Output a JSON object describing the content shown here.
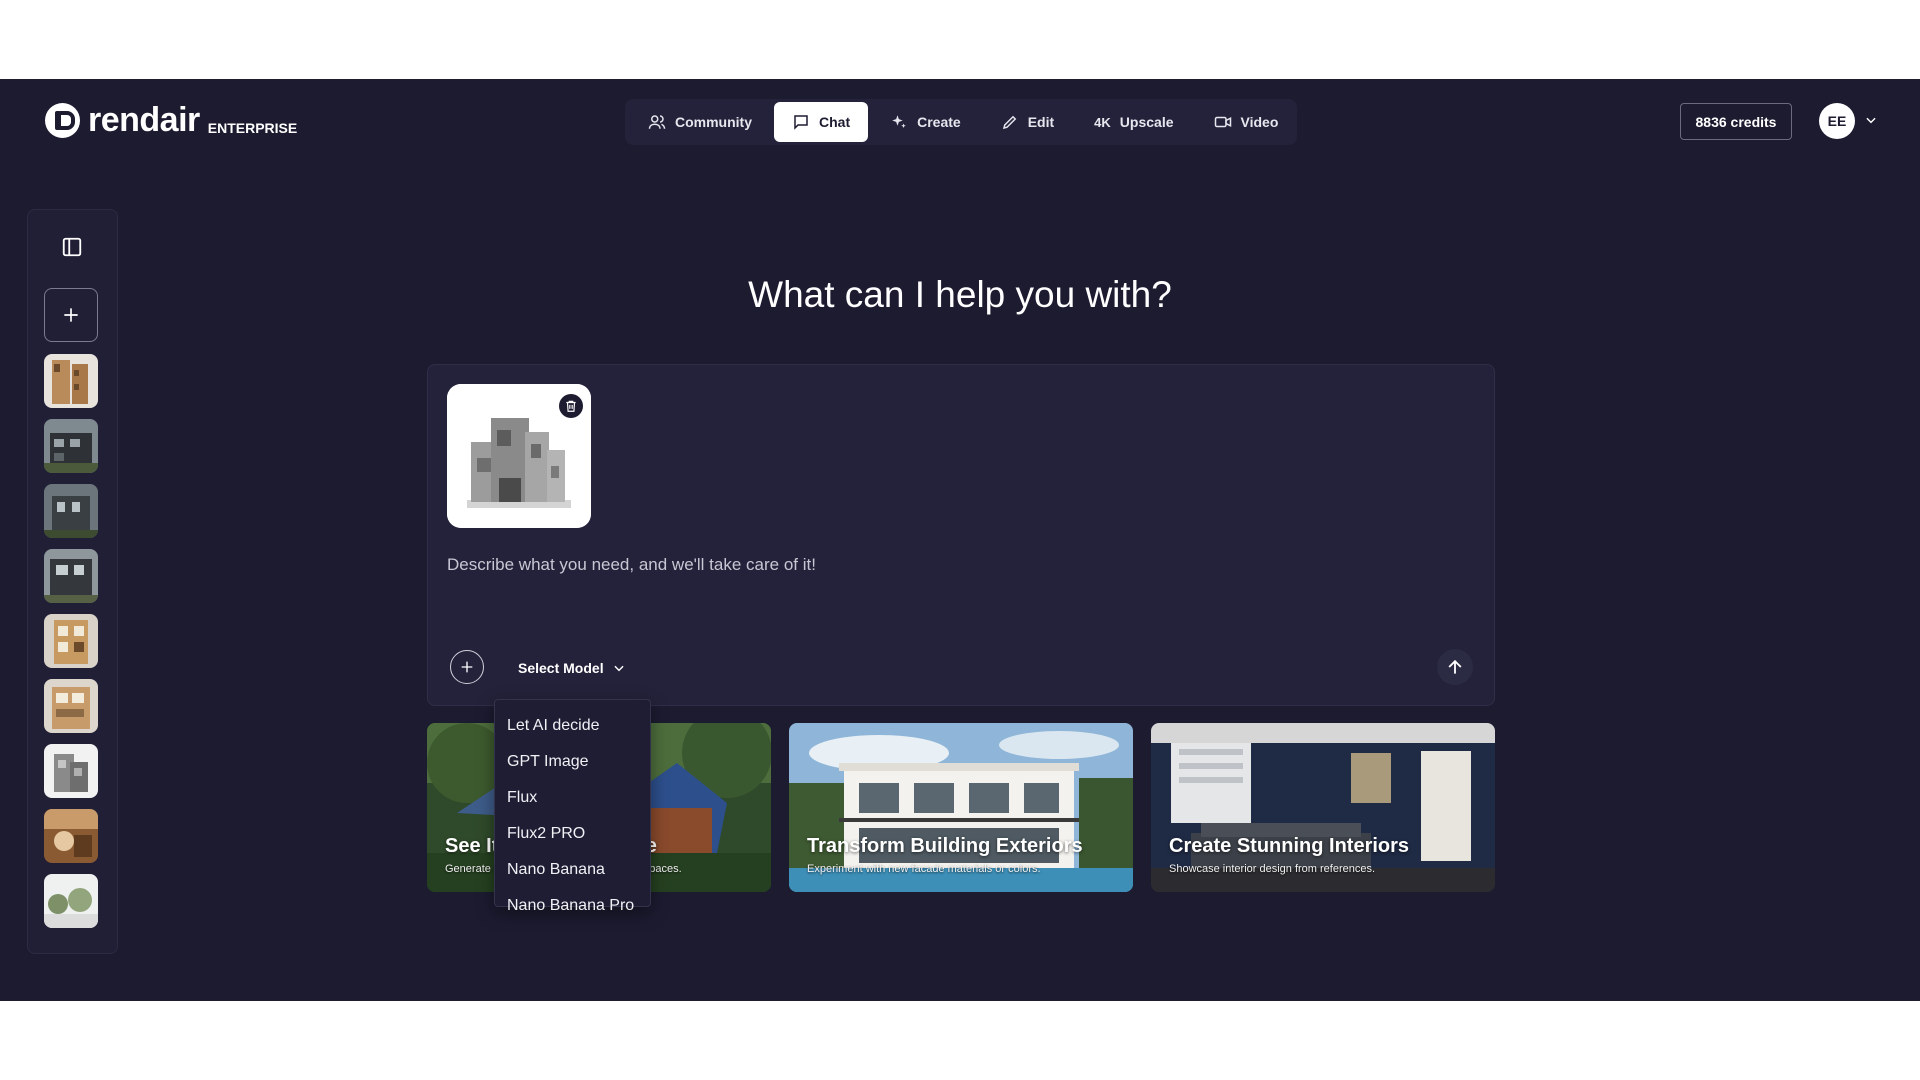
{
  "brand": {
    "name": "rendair",
    "tier": "ENTERPRISE"
  },
  "nav": {
    "items": [
      {
        "label": "Community",
        "icon": "users-icon",
        "active": false
      },
      {
        "label": "Chat",
        "icon": "chat-icon",
        "active": true
      },
      {
        "label": "Create",
        "icon": "sparkle-icon",
        "active": false
      },
      {
        "label": "Edit",
        "icon": "pencil-icon",
        "active": false
      },
      {
        "label": "Upscale",
        "icon": "4k-icon",
        "active": false,
        "prefix": "4K"
      },
      {
        "label": "Video",
        "icon": "video-icon",
        "active": false
      }
    ]
  },
  "account": {
    "credits": "8836 credits",
    "initials": "EE"
  },
  "main": {
    "headline": "What can I help you with?",
    "prompt_placeholder": "Describe what you need, and we'll take care of it!",
    "model_select_label": "Select Model"
  },
  "model_dropdown": {
    "options": [
      "Let AI decide",
      "GPT Image",
      "Flux",
      "Flux2 PRO",
      "Nano Banana",
      "Nano Banana Pro"
    ]
  },
  "cards": [
    {
      "title": "See It From Any Angle",
      "subtitle": "Generate new views of your buildings or spaces."
    },
    {
      "title": "Transform Building Exteriors",
      "subtitle": "Experiment with new facade materials or colors."
    },
    {
      "title": "Create Stunning Interiors",
      "subtitle": "Showcase interior design from references."
    }
  ],
  "colors": {
    "background": "#1c1b30",
    "panel": "#23223a",
    "accent_arrow": "#f5921e",
    "active_tab": "#ffffff"
  }
}
